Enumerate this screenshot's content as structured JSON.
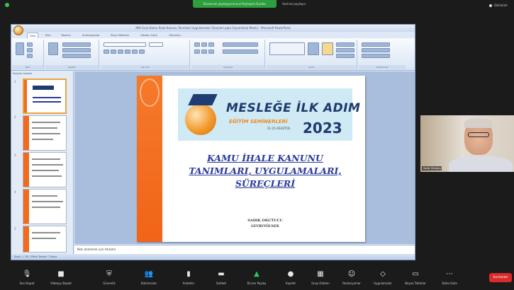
{
  "topbar": {
    "share_banner": "Ekranınızı paylaşıyorsunuz  Paylaşımı Durdur",
    "share_extra": "Sesinizi paylaşın",
    "view_label": "Görünüm"
  },
  "ppt": {
    "title": "IMO Ecza Kamu İhale Kanunu Tanımları Uygulamaları Süreçleri.pptx [Uyumluluk Modu] - Microsoft PowerPoint",
    "tabs": [
      "Giriş",
      "Ekle",
      "Tasarım",
      "Animasyonlar",
      "Slayt Gösterisi",
      "Gözden Geçir",
      "Görünüm"
    ],
    "ribbon_groups": [
      "Pano",
      "Slaytlar",
      "Yazı Tipi",
      "Paragraf",
      "Çizim",
      "Düzenleme"
    ],
    "panel_tabs": "Slaytlar  Anahat",
    "slide_numbers": [
      "1",
      "2",
      "3",
      "4",
      "5",
      "6"
    ],
    "notes": "Not eklemek için tıklatın",
    "status": "Slayt 1 / 36   \"Office Teması\"   Türkçe"
  },
  "slide": {
    "logo_title": "MESLEĞE İLK ADIM",
    "logo_sub": "EĞİTİM SEMİNERLERİ",
    "logo_dates": "21-25 AĞUSTOS",
    "logo_year": "2023",
    "title_line1": "KAMU İHALE KANUNU",
    "title_line2": "TANIMLARI, UYGULAMALARI,",
    "title_line3": "SÜREÇLERİ",
    "presenter": "SADIK OKUTUCU",
    "presenter_role": "GEVREYÖLNEK"
  },
  "video": {
    "participant_name": "Sadık Okutucu"
  },
  "toolbar": {
    "items": [
      {
        "icon": "microphone-icon",
        "label": "Sesi Kapat"
      },
      {
        "icon": "video-camera-icon",
        "label": "Videoyu Başlat"
      },
      {
        "icon": "security-shield-icon",
        "label": "Güvenlik"
      },
      {
        "icon": "participants-icon",
        "label": "Katılımcılar"
      },
      {
        "icon": "poll-icon",
        "label": "Anketler"
      },
      {
        "icon": "chat-icon",
        "label": "Sohbet"
      },
      {
        "icon": "share-screen-icon",
        "label": "Ekranı Paylaş"
      },
      {
        "icon": "record-icon",
        "label": "Kaydet"
      },
      {
        "icon": "breakout-rooms-icon",
        "label": "Grup Odaları"
      },
      {
        "icon": "reactions-icon",
        "label": "Reaksiyonlar"
      },
      {
        "icon": "apps-icon",
        "label": "Uygulamalar"
      },
      {
        "icon": "whiteboard-icon",
        "label": "Beyaz Tahtalar"
      },
      {
        "icon": "more-icon",
        "label": "Daha fazla"
      }
    ],
    "end_label": "Sonlandır"
  },
  "colors": {
    "zoom_green": "#2f9e3c",
    "slide_orange": "#f26418",
    "logo_navy": "#1e3a6e",
    "end_red": "#d92b2b"
  }
}
